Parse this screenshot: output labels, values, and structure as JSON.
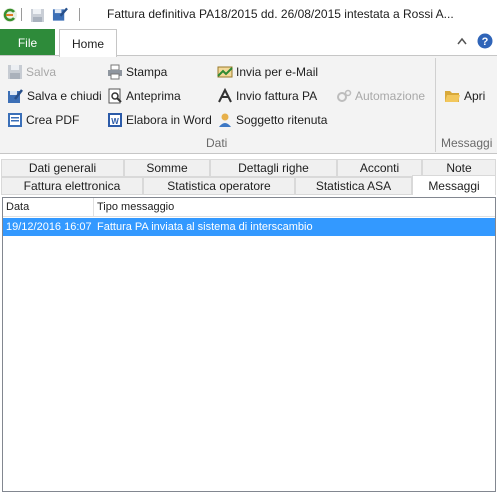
{
  "window": {
    "title": "Fattura definitiva PA18/2015 dd. 26/08/2015 intestata a Rossi A..."
  },
  "ribbon_tabs": {
    "file": "File",
    "home": "Home"
  },
  "ribbon": {
    "dati": {
      "salva": "Salva",
      "salva_e_chiudi": "Salva e chiudi",
      "crea_pdf": "Crea PDF",
      "stampa": "Stampa",
      "anteprima": "Anteprima",
      "elabora_in_word": "Elabora in Word",
      "invia_email": "Invia per e-Mail",
      "invio_fattura_pa": "Invio fattura PA",
      "soggetto_ritenuta": "Soggetto ritenuta",
      "automazione": "Automazione",
      "label": "Dati"
    },
    "messaggi": {
      "apri": "Apri",
      "label": "Messaggi"
    }
  },
  "content_tabs": {
    "row1": [
      "Dati generali",
      "Somme",
      "Dettagli righe",
      "Acconti",
      "Note"
    ],
    "row2": [
      "Fattura elettronica",
      "Statistica operatore",
      "Statistica ASA",
      "Messaggi"
    ],
    "active": "Messaggi"
  },
  "grid": {
    "columns": [
      "Data",
      "Tipo messaggio"
    ],
    "rows": [
      [
        "19/12/2016 16:07",
        "Fattura PA inviata al sistema di interscambio"
      ]
    ]
  }
}
